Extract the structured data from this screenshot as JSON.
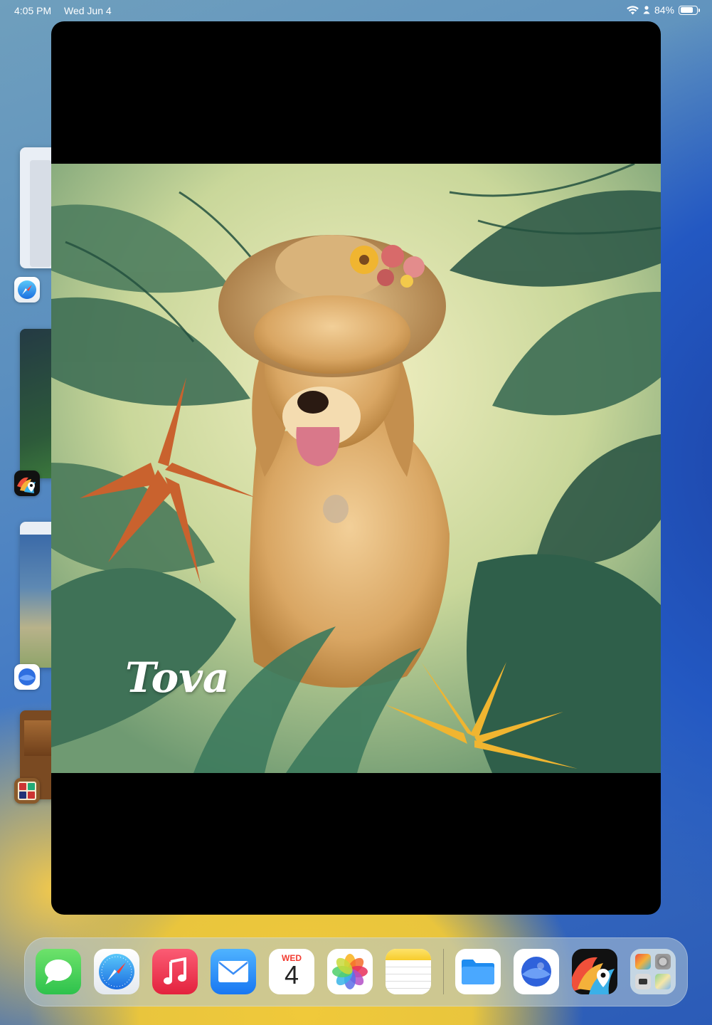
{
  "status_bar": {
    "time": "4:05 PM",
    "date": "Wed Jun 4",
    "battery": "84%",
    "battery_level": 0.84
  },
  "artwork": {
    "name_text": "Tova"
  },
  "dock": {
    "calendar_day": "WED",
    "calendar_date": "4"
  }
}
